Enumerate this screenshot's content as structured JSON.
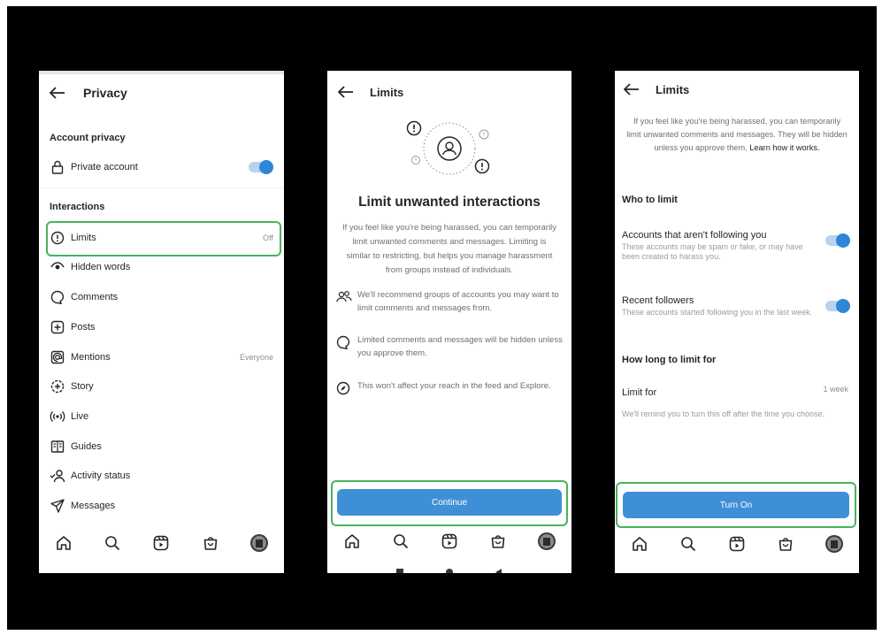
{
  "screen1": {
    "title": "Privacy",
    "account_privacy_heading": "Account privacy",
    "private_account_label": "Private account",
    "private_account_on": true,
    "interactions_heading": "Interactions",
    "items": [
      {
        "label": "Limits",
        "value": "Off",
        "icon": "limits-icon"
      },
      {
        "label": "Hidden words",
        "value": "",
        "icon": "eye-icon"
      },
      {
        "label": "Comments",
        "value": "",
        "icon": "comment-icon"
      },
      {
        "label": "Posts",
        "value": "",
        "icon": "plus-square-icon"
      },
      {
        "label": "Mentions",
        "value": "Everyone",
        "icon": "at-icon"
      },
      {
        "label": "Story",
        "value": "",
        "icon": "story-icon"
      },
      {
        "label": "Live",
        "value": "",
        "icon": "live-icon"
      },
      {
        "label": "Guides",
        "value": "",
        "icon": "guides-icon"
      },
      {
        "label": "Activity status",
        "value": "",
        "icon": "activity-icon"
      },
      {
        "label": "Messages",
        "value": "",
        "icon": "send-icon"
      }
    ]
  },
  "screen2": {
    "title": "Limits",
    "heading": "Limit unwanted interactions",
    "intro": "If you feel like you're being harassed, you can temporarily limit unwanted comments and messages. Limiting is similar to restricting, but helps you manage harassment from groups instead of individuals.",
    "bullets": [
      {
        "text": "We'll recommend groups of accounts you may want to limit comments and messages from.",
        "icon": "people-icon"
      },
      {
        "text": "Limited comments and messages will be hidden unless you approve them.",
        "icon": "comment-icon"
      },
      {
        "text": "This won't affect your reach in the feed and Explore.",
        "icon": "compass-icon"
      }
    ],
    "button": "Continue"
  },
  "screen3": {
    "title": "Limits",
    "intro": "If you feel like you're being harassed, you can temporarily limit unwanted comments and messages. They will be hidden unless you approve them.",
    "learn_more": "Learn how it works.",
    "who_heading": "Who to limit",
    "options": [
      {
        "title": "Accounts that aren't following you",
        "desc": "These accounts may be spam or fake, or may have been created to harass you.",
        "on": true
      },
      {
        "title": "Recent followers",
        "desc": "These accounts started following you in the last week.",
        "on": true
      }
    ],
    "how_long_heading": "How long to limit for",
    "limit_for_label": "Limit for",
    "limit_for_value": "1 week",
    "reminder": "We'll remind you to turn this off after the time you choose.",
    "button": "Turn On"
  },
  "colors": {
    "accent": "#3f8fd6",
    "highlight": "#49b35b",
    "frame": "#000000"
  },
  "tabbar_icons": [
    "home-icon",
    "search-icon",
    "reels-icon",
    "shop-icon",
    "profile-avatar"
  ]
}
